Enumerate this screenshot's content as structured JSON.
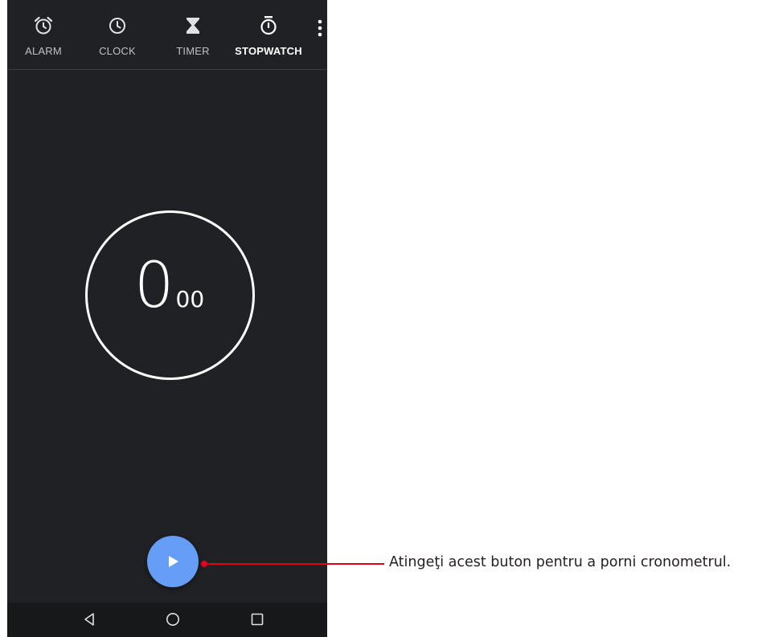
{
  "tabs": {
    "alarm": {
      "label": "ALARM",
      "icon": "alarm-clock-icon"
    },
    "clock": {
      "label": "CLOCK",
      "icon": "clock-icon"
    },
    "timer": {
      "label": "TIMER",
      "icon": "hourglass-icon"
    },
    "stopwatch": {
      "label": "STOPWATCH",
      "icon": "stopwatch-icon",
      "active": true
    }
  },
  "overflow_menu": {
    "icon": "more-vert-icon"
  },
  "stopwatch": {
    "seconds": "0",
    "hundredths": "00"
  },
  "play_button": {
    "icon": "play-icon"
  },
  "navigation": {
    "back": {
      "icon": "back-triangle-icon"
    },
    "home": {
      "icon": "home-circle-icon"
    },
    "recents": {
      "icon": "recents-square-icon"
    }
  },
  "callout": {
    "text": "Atingeţi acest buton pentru a porni cronometrul.",
    "color": "#e2001a"
  },
  "colors": {
    "background": "#202124",
    "accent": "#669df6",
    "text": "#ffffff",
    "nav_bar": "#17181a"
  }
}
